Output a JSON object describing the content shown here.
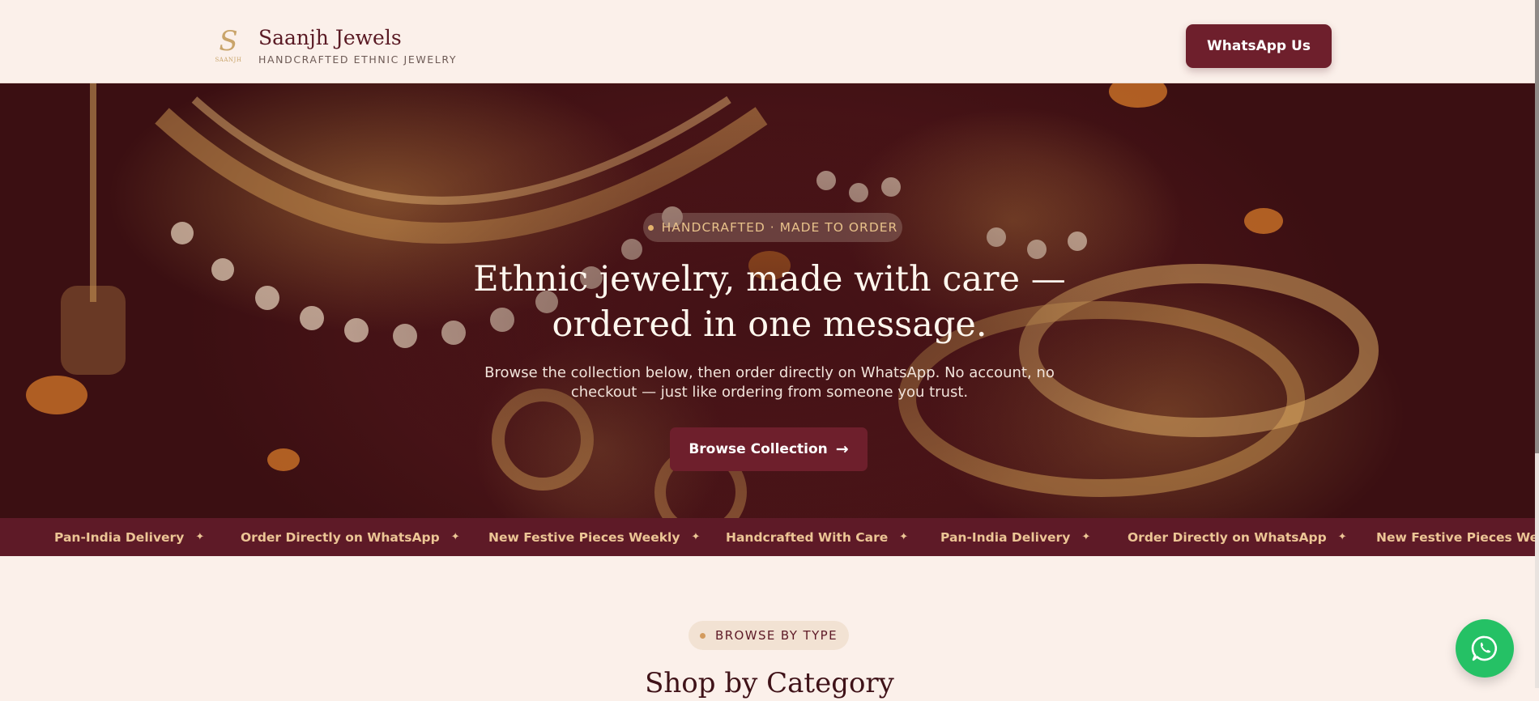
{
  "header": {
    "logo_mark": "S",
    "logo_tiny": "SAANJH",
    "brand_name": "Saanjh Jewels",
    "brand_tagline": "HANDCRAFTED ETHNIC JEWELRY",
    "whatsapp_label": "WhatsApp Us"
  },
  "hero": {
    "badge": "HANDCRAFTED · MADE TO ORDER",
    "title_line1": "Ethnic jewelry, made with care —",
    "title_line2": "ordered in one message.",
    "subtitle_line1": "Browse the collection below, then order directly on WhatsApp. No account, no",
    "subtitle_line2": "checkout — just like ordering from someone you trust.",
    "cta_label": "Browse Collection",
    "cta_arrow": "→"
  },
  "marquee": {
    "separator": "✦",
    "items": [
      "Pan-India Delivery",
      "Order Directly on WhatsApp",
      "New Festive Pieces Weekly",
      "Handcrafted With Care",
      "Pan-India Delivery",
      "Order Directly on WhatsApp",
      "New Festive Pieces Weekly"
    ]
  },
  "category_section": {
    "badge": "BROWSE BY TYPE",
    "title": "Shop by Category"
  },
  "floating": {
    "icon": "whatsapp-icon"
  },
  "colors": {
    "page_bg": "#fbf0ea",
    "brand_maroon": "#6e1f2c",
    "marquee_bg": "#5e1a27",
    "gold": "#e7c18a",
    "whatsapp_green": "#25c165"
  }
}
